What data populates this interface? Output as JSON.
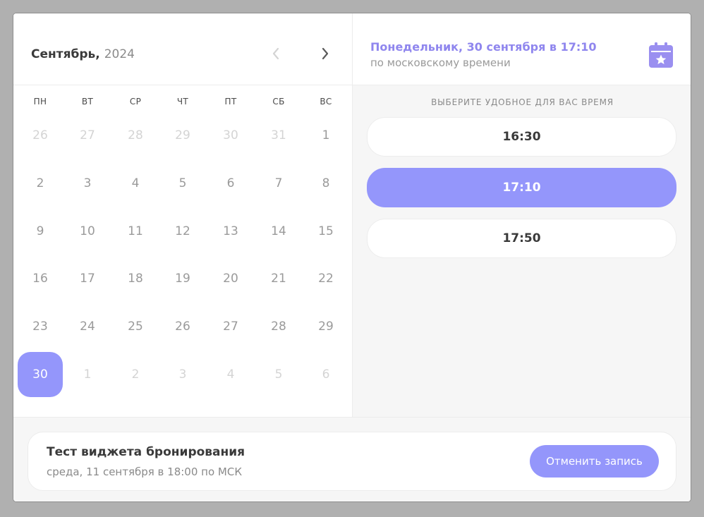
{
  "calendar": {
    "month": "Сентябрь,",
    "year": "2024",
    "weekdays": [
      "ПН",
      "ВТ",
      "СР",
      "ЧТ",
      "ПТ",
      "СБ",
      "ВС"
    ],
    "weeks": [
      [
        {
          "d": "26",
          "other": true
        },
        {
          "d": "27",
          "other": true
        },
        {
          "d": "28",
          "other": true
        },
        {
          "d": "29",
          "other": true
        },
        {
          "d": "30",
          "other": true
        },
        {
          "d": "31",
          "other": true
        },
        {
          "d": "1"
        }
      ],
      [
        {
          "d": "2"
        },
        {
          "d": "3"
        },
        {
          "d": "4"
        },
        {
          "d": "5"
        },
        {
          "d": "6"
        },
        {
          "d": "7"
        },
        {
          "d": "8"
        }
      ],
      [
        {
          "d": "9"
        },
        {
          "d": "10"
        },
        {
          "d": "11"
        },
        {
          "d": "12"
        },
        {
          "d": "13"
        },
        {
          "d": "14"
        },
        {
          "d": "15"
        }
      ],
      [
        {
          "d": "16"
        },
        {
          "d": "17"
        },
        {
          "d": "18"
        },
        {
          "d": "19"
        },
        {
          "d": "20"
        },
        {
          "d": "21"
        },
        {
          "d": "22"
        }
      ],
      [
        {
          "d": "23"
        },
        {
          "d": "24"
        },
        {
          "d": "25"
        },
        {
          "d": "26"
        },
        {
          "d": "27"
        },
        {
          "d": "28"
        },
        {
          "d": "29"
        }
      ],
      [
        {
          "d": "30",
          "selected": true
        },
        {
          "d": "1",
          "other": true
        },
        {
          "d": "2",
          "other": true
        },
        {
          "d": "3",
          "other": true
        },
        {
          "d": "4",
          "other": true
        },
        {
          "d": "5",
          "other": true
        },
        {
          "d": "6",
          "other": true
        }
      ]
    ]
  },
  "selection": {
    "date_text": "Понедельник, 30 сентября в 17:10",
    "timezone_text": "по московскому времени"
  },
  "slots": {
    "title": "ВЫБЕРИТЕ УДОБНОЕ ДЛЯ ВАС ВРЕМЯ",
    "items": [
      {
        "time": "16:30",
        "active": false
      },
      {
        "time": "17:10",
        "active": true
      },
      {
        "time": "17:50",
        "active": false
      }
    ]
  },
  "booking": {
    "title": "Тест виджета бронирования",
    "subtitle": "среда, 11 сентября в 18:00 по МСК",
    "cancel_label": "Отменить запись"
  },
  "colors": {
    "accent": "#9496fb",
    "accent_text": "#8f86ee",
    "icon": "#9a8ff0"
  },
  "icons": {
    "prev": "chevron-left-icon",
    "next": "chevron-right-icon",
    "calendar": "calendar-star-icon"
  }
}
